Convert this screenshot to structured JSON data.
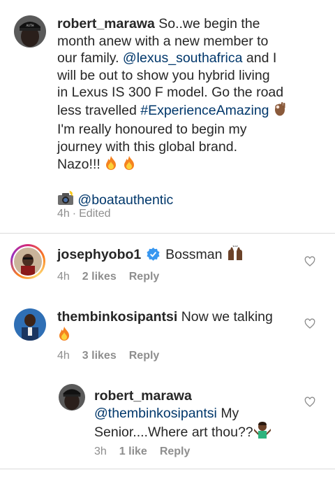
{
  "post": {
    "username": "robert_marawa",
    "caption_lines": [
      "So..we begin the",
      "month anew with a new member to",
      "our family.",
      "and I",
      "will be out to show you hybrid living",
      "in Lexus IS 300 F  model. Go the road",
      "less travelled",
      "I'm really honoured to begin my",
      "journey with this global brand.",
      "Nazo!!!"
    ],
    "mention_lexus": "@lexus_southafrica",
    "hashtag": "#ExperienceAmazing",
    "photo_credit": "@boatauthentic",
    "time": "4h",
    "edited": "Edited",
    "meta_sep": "·"
  },
  "comments": [
    {
      "username": "josephyobo1",
      "text": "Bossman",
      "time": "4h",
      "likes": "2 likes",
      "reply": "Reply"
    },
    {
      "username": "thembinkosipantsi",
      "text": "Now we talking",
      "time": "4h",
      "likes": "3 likes",
      "reply": "Reply"
    }
  ],
  "reply": {
    "username": "robert_marawa",
    "mention": "@thembinkosipantsi",
    "text_1": "My",
    "text_2": "Senior....Where art thou??",
    "time": "3h",
    "likes": "1 like",
    "reply": "Reply"
  },
  "colors": {
    "text": "#262626",
    "link": "#00376b",
    "meta": "#8e8e8e",
    "verified": "#3897f0",
    "divider": "#dbdbdb"
  },
  "icons": [
    "fire-icon",
    "ok-hand-icon",
    "camera-flash-icon",
    "raised-hands-icon",
    "shrug-icon",
    "heart-icon",
    "verified-badge-icon"
  ]
}
